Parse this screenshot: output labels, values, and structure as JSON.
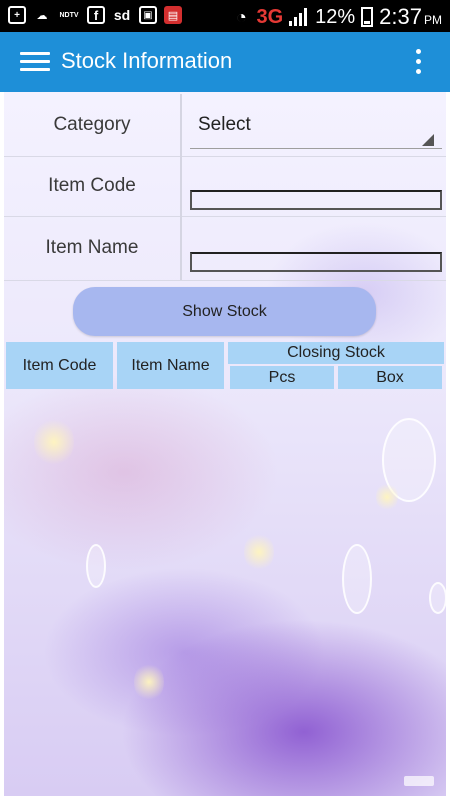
{
  "status_bar": {
    "left_icons": [
      "add-notification-icon",
      "cloud-sync-icon",
      "ndtv-icon",
      "facebook-icon",
      "sd-card-icon",
      "gallery-icon",
      "app-notification-icon"
    ],
    "ndtv": "NDTV",
    "facebook": "f",
    "sd": "sd",
    "network": "3G",
    "battery_pct": "12%",
    "time": "2:37",
    "ampm": "PM"
  },
  "app_bar": {
    "title": "Stock Information",
    "color": "#1e8fd8"
  },
  "form": {
    "category_label": "Category",
    "category_value": "Select",
    "item_code_label": "Item Code",
    "item_code_value": "",
    "item_name_label": "Item Name",
    "item_name_value": ""
  },
  "show_stock_label": "Show Stock",
  "table": {
    "col_item_code": "Item Code",
    "col_item_name": "Item Name",
    "col_closing_stock": "Closing Stock",
    "sub_pcs": "Pcs",
    "sub_box": "Box",
    "header_color": "#a8d4f6"
  }
}
